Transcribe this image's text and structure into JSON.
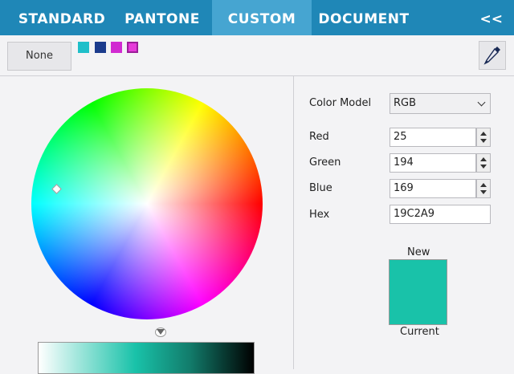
{
  "tabs": [
    {
      "label": "STANDARD"
    },
    {
      "label": "PANTONE"
    },
    {
      "label": "CUSTOM",
      "active": true
    },
    {
      "label": "DOCUMENT"
    }
  ],
  "collapse_label": "<<",
  "toolbar": {
    "none_label": "None",
    "swatches": [
      "#1fbfc9",
      "#1b3b8c",
      "#d12ad1",
      "#e63bd9"
    ],
    "eyedropper_icon": "eyedropper-icon"
  },
  "color_model": {
    "label": "Color Model",
    "value": "RGB"
  },
  "channels": {
    "red": {
      "label": "Red",
      "value": "25"
    },
    "green": {
      "label": "Green",
      "value": "194"
    },
    "blue": {
      "label": "Blue",
      "value": "169"
    },
    "hex": {
      "label": "Hex",
      "value": "19C2A9"
    }
  },
  "preview": {
    "new_label": "New",
    "current_label": "Current",
    "new_color": "#19c2a9"
  },
  "colors": {
    "tab_bar": "#1f87b7",
    "tab_active": "#46a5d1"
  }
}
